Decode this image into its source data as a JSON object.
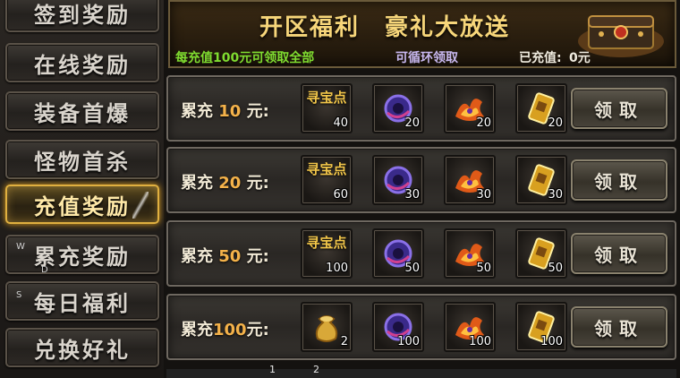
{
  "sidebar": {
    "items": [
      {
        "label": "签到奖励"
      },
      {
        "label": "在线奖励"
      },
      {
        "label": "装备首爆"
      },
      {
        "label": "怪物首杀"
      },
      {
        "label": "充值奖励",
        "active": true
      },
      {
        "label": "累充奖励"
      },
      {
        "label": "每日福利"
      },
      {
        "label": "兑换好礼"
      }
    ],
    "stray_letters": [
      "W",
      "D",
      "S"
    ]
  },
  "banner": {
    "title": "开区福利　豪礼大放送",
    "note_all": "每充值100元可领取全部",
    "note_cycle": "可循环领取",
    "charged_label": "已充值:",
    "charged_value": "0元"
  },
  "tiers": [
    {
      "prefix": "累充 ",
      "amount": "10",
      "suffix": " 元:",
      "rewards": [
        {
          "icon": "treasure-points",
          "text": "寻宝点",
          "count": "40"
        },
        {
          "icon": "purple-orb-icon",
          "count": "20"
        },
        {
          "icon": "phoenix-flame-icon",
          "count": "20"
        },
        {
          "icon": "gold-scroll-icon",
          "count": "20"
        }
      ],
      "button": "领取"
    },
    {
      "prefix": "累充 ",
      "amount": "20",
      "suffix": " 元:",
      "rewards": [
        {
          "icon": "treasure-points",
          "text": "寻宝点",
          "count": "60"
        },
        {
          "icon": "purple-orb-icon",
          "count": "30"
        },
        {
          "icon": "phoenix-flame-icon",
          "count": "30"
        },
        {
          "icon": "gold-scroll-icon",
          "count": "30"
        }
      ],
      "button": "领取"
    },
    {
      "prefix": "累充 ",
      "amount": "50",
      "suffix": " 元:",
      "rewards": [
        {
          "icon": "treasure-points",
          "text": "寻宝点",
          "count": "100"
        },
        {
          "icon": "purple-orb-icon",
          "count": "50"
        },
        {
          "icon": "phoenix-flame-icon",
          "count": "50"
        },
        {
          "icon": "gold-scroll-icon",
          "count": "50"
        }
      ],
      "button": "领取"
    },
    {
      "prefix": "累充",
      "amount": "100",
      "suffix": "元:",
      "rewards": [
        {
          "icon": "gold-pouch-icon",
          "count": "2"
        },
        {
          "icon": "purple-orb-icon",
          "count": "100"
        },
        {
          "icon": "phoenix-flame-icon",
          "count": "100"
        },
        {
          "icon": "gold-scroll-icon",
          "count": "100"
        }
      ],
      "button": "领取"
    }
  ],
  "pager": [
    "1",
    "2"
  ],
  "colors": {
    "gold": "#f7d67a",
    "amount": "#f4b24a",
    "green": "#7fdc30",
    "active_border": "#e0b040"
  }
}
